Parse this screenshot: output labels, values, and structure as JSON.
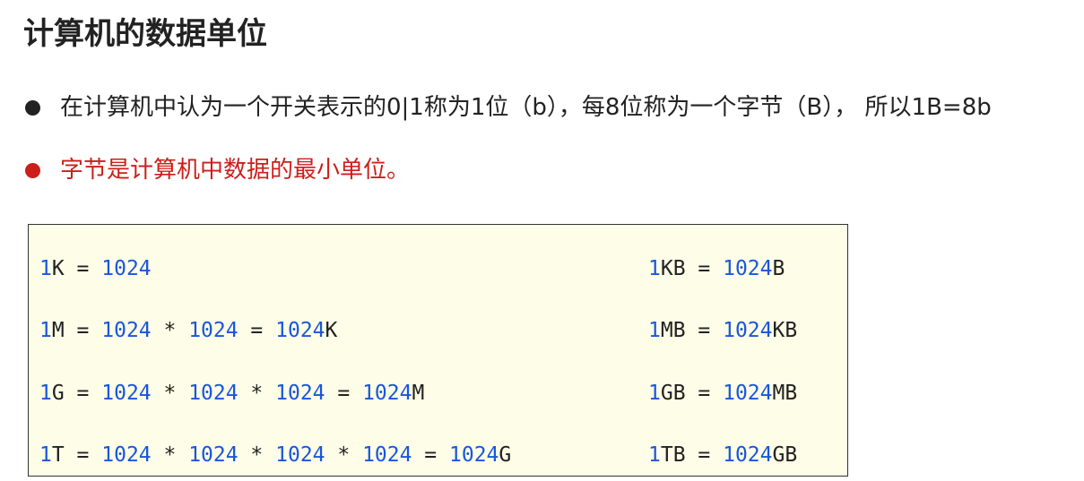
{
  "title": "计算机的数据单位",
  "bullets": [
    {
      "text": "在计算机中认为一个开关表示的0|1称为1位（b），每8位称为一个字节（B）， 所以1B=8b",
      "color": "#222222"
    },
    {
      "text": "字节是计算机中数据的最小单位。",
      "color": "#cc1f1a"
    }
  ],
  "colors": {
    "number": "#1a56db",
    "text": "#222222",
    "box_background": "#fdfde8"
  },
  "code_lines": {
    "left": [
      [
        {
          "t": "1",
          "k": "n"
        },
        {
          "t": "K = ",
          "k": "p"
        },
        {
          "t": "1024",
          "k": "n"
        }
      ],
      [
        {
          "t": "1",
          "k": "n"
        },
        {
          "t": "M = ",
          "k": "p"
        },
        {
          "t": "1024",
          "k": "n"
        },
        {
          "t": " * ",
          "k": "p"
        },
        {
          "t": "1024",
          "k": "n"
        },
        {
          "t": " = ",
          "k": "p"
        },
        {
          "t": "1024",
          "k": "n"
        },
        {
          "t": "K",
          "k": "p"
        }
      ],
      [
        {
          "t": "1",
          "k": "n"
        },
        {
          "t": "G = ",
          "k": "p"
        },
        {
          "t": "1024",
          "k": "n"
        },
        {
          "t": " * ",
          "k": "p"
        },
        {
          "t": "1024",
          "k": "n"
        },
        {
          "t": " * ",
          "k": "p"
        },
        {
          "t": "1024",
          "k": "n"
        },
        {
          "t": " = ",
          "k": "p"
        },
        {
          "t": "1024",
          "k": "n"
        },
        {
          "t": "M",
          "k": "p"
        }
      ],
      [
        {
          "t": "1",
          "k": "n"
        },
        {
          "t": "T = ",
          "k": "p"
        },
        {
          "t": "1024",
          "k": "n"
        },
        {
          "t": " * ",
          "k": "p"
        },
        {
          "t": "1024",
          "k": "n"
        },
        {
          "t": " * ",
          "k": "p"
        },
        {
          "t": "1024",
          "k": "n"
        },
        {
          "t": " * ",
          "k": "p"
        },
        {
          "t": "1024",
          "k": "n"
        },
        {
          "t": " = ",
          "k": "p"
        },
        {
          "t": "1024",
          "k": "n"
        },
        {
          "t": "G",
          "k": "p"
        }
      ]
    ],
    "right": [
      [
        {
          "t": "1",
          "k": "n"
        },
        {
          "t": "KB = ",
          "k": "p"
        },
        {
          "t": "1024",
          "k": "n"
        },
        {
          "t": "B",
          "k": "p"
        }
      ],
      [
        {
          "t": "1",
          "k": "n"
        },
        {
          "t": "MB = ",
          "k": "p"
        },
        {
          "t": "1024",
          "k": "n"
        },
        {
          "t": "KB",
          "k": "p"
        }
      ],
      [
        {
          "t": "1",
          "k": "n"
        },
        {
          "t": "GB = ",
          "k": "p"
        },
        {
          "t": "1024",
          "k": "n"
        },
        {
          "t": "MB",
          "k": "p"
        }
      ],
      [
        {
          "t": "1",
          "k": "n"
        },
        {
          "t": "TB = ",
          "k": "p"
        },
        {
          "t": "1024",
          "k": "n"
        },
        {
          "t": "GB",
          "k": "p"
        }
      ]
    ]
  }
}
